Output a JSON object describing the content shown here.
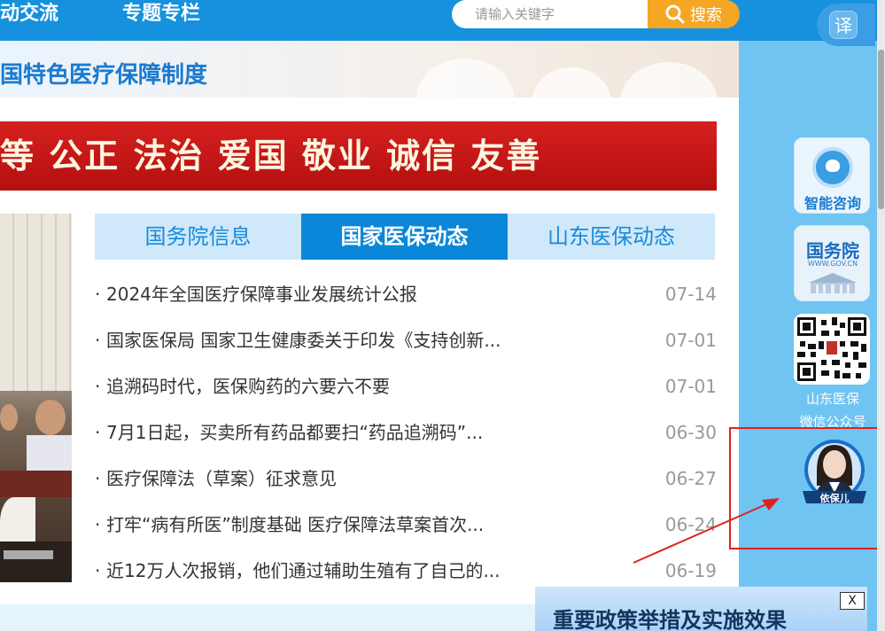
{
  "header": {
    "nav_items": [
      {
        "label": "动交流"
      },
      {
        "label": "专题专栏"
      }
    ],
    "search": {
      "placeholder": "请输入关键字",
      "button_label": "搜索"
    },
    "translate_label": "译"
  },
  "banner": {
    "title": "国特色医疗保障制度",
    "values_text": "等  公正  法治  爱国  敬业  诚信  友善"
  },
  "tabs": [
    {
      "label": "国务院信息",
      "active": false
    },
    {
      "label": "国家医保动态",
      "active": true
    },
    {
      "label": "山东医保动态",
      "active": false
    }
  ],
  "news": [
    {
      "title": "2024年全国医疗保障事业发展统计公报",
      "date": "07-14"
    },
    {
      "title": "国家医保局 国家卫生健康委关于印发《支持创新...",
      "date": "07-01"
    },
    {
      "title": "追溯码时代，医保购药的六要六不要",
      "date": "07-01"
    },
    {
      "title": "7月1日起，买卖所有药品都要扫“药品追溯码”...",
      "date": "06-30"
    },
    {
      "title": "医疗保障法（草案）征求意见",
      "date": "06-27"
    },
    {
      "title": "打牢“病有所医”制度基础 医疗保障法草案首次...",
      "date": "06-24"
    },
    {
      "title": "近12万人次报销，他们通过辅助生殖有了自己的...",
      "date": "06-19"
    }
  ],
  "bullet": "·",
  "sidebar": {
    "ai_consult_label": "智能咨询",
    "gov_label": "国务院",
    "gov_sub": "WWW.GOV.CN",
    "qr_caption_line1": "山东医保",
    "qr_caption_line2": "微信公众号",
    "assistant_label": "依保儿"
  },
  "popup": {
    "title": "重要政策举措及实施效果",
    "close_label": "X"
  },
  "colors": {
    "nav_blue": "#1591dd",
    "accent_orange": "#f5a623",
    "tab_active": "#0a87d8",
    "banner_red": "#c8161d",
    "highlight_red": "#e02020"
  }
}
